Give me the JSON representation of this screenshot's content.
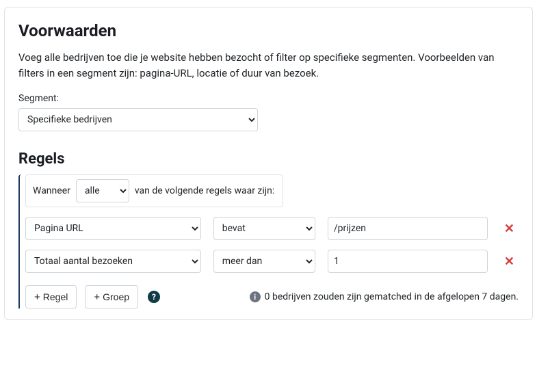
{
  "conditions": {
    "title": "Voorwaarden",
    "description": "Voeg alle bedrijven toe die je website hebben bezocht of filter op specifieke segmenten. Voorbeelden van filters in een segment zijn: pagina-URL, locatie of duur van bezoek.",
    "segment_label": "Segment:",
    "segment_selected": "Specifieke bedrijven"
  },
  "rules": {
    "title": "Regels",
    "when_label": "Wanneer",
    "quantifier_selected": "alle",
    "tail_label": "van de volgende regels waar zijn:",
    "items": [
      {
        "field": "Pagina URL",
        "operator": "bevat",
        "value": "/prijzen"
      },
      {
        "field": "Totaal aantal bezoeken",
        "operator": "meer dan",
        "value": "1"
      }
    ],
    "add_rule_label": "Regel",
    "add_group_label": "Groep",
    "help_glyph": "?",
    "info_glyph": "i",
    "match_summary": "0 bedrijven zouden zijn gematched in de afgelopen 7 dagen."
  }
}
